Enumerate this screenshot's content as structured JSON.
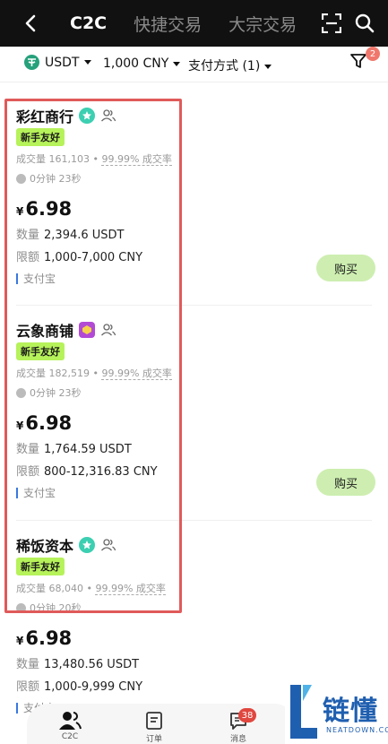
{
  "header": {
    "tabs": [
      {
        "label": "C2C",
        "active": true
      },
      {
        "label": "快捷交易",
        "active": false
      },
      {
        "label": "大宗交易",
        "active": false
      }
    ]
  },
  "filters": {
    "coin": "USDT",
    "amount": "1,000 CNY",
    "payment": "支付方式 (1)",
    "filter_badge": "2"
  },
  "listings": [
    {
      "merchant": "彩红商行",
      "badge_color": "#3ccfb1",
      "tag": "新手友好",
      "volume": "成交量 161,103",
      "rate": "99.99% 成交率",
      "time": "0分钟 23秒",
      "currency_symbol": "¥",
      "price": "6.98",
      "qty_label": "数量",
      "qty": "2,394.6 USDT",
      "limit_label": "限额",
      "limit": "1,000-7,000 CNY",
      "payment": "支付宝",
      "buy_label": "购买"
    },
    {
      "merchant": "云象商铺",
      "badge_color": "#b24ad6",
      "tag": "新手友好",
      "volume": "成交量 182,519",
      "rate": "99.99% 成交率",
      "time": "0分钟 23秒",
      "currency_symbol": "¥",
      "price": "6.98",
      "qty_label": "数量",
      "qty": "1,764.59 USDT",
      "limit_label": "限额",
      "limit": "800-12,316.83 CNY",
      "payment": "支付宝",
      "buy_label": "购买"
    },
    {
      "merchant": "稀饭资本",
      "badge_color": "#3ccfb1",
      "tag": "新手友好",
      "volume": "成交量 68,040",
      "rate": "99.99% 成交率",
      "time": "0分钟 20秒",
      "currency_symbol": "¥",
      "price": "6.98",
      "qty_label": "数量",
      "qty": "13,480.56 USDT",
      "limit_label": "限额",
      "limit": "1,000-9,999 CNY",
      "payment": "支付宝"
    }
  ],
  "bottom_nav": {
    "items": [
      {
        "label": "C2C",
        "icon": "user-group-icon"
      },
      {
        "label": "订单",
        "icon": "order-icon"
      },
      {
        "label": "消息",
        "icon": "message-icon"
      }
    ],
    "message_badge": "38"
  },
  "watermark": {
    "text": "链懂",
    "sub": "NEATDOWN.COM"
  },
  "colors": {
    "accent_green": "#b6f25a",
    "buy_button": "#cdeeb0",
    "highlight_red": "#e05a5a",
    "header_bg": "#111111"
  }
}
